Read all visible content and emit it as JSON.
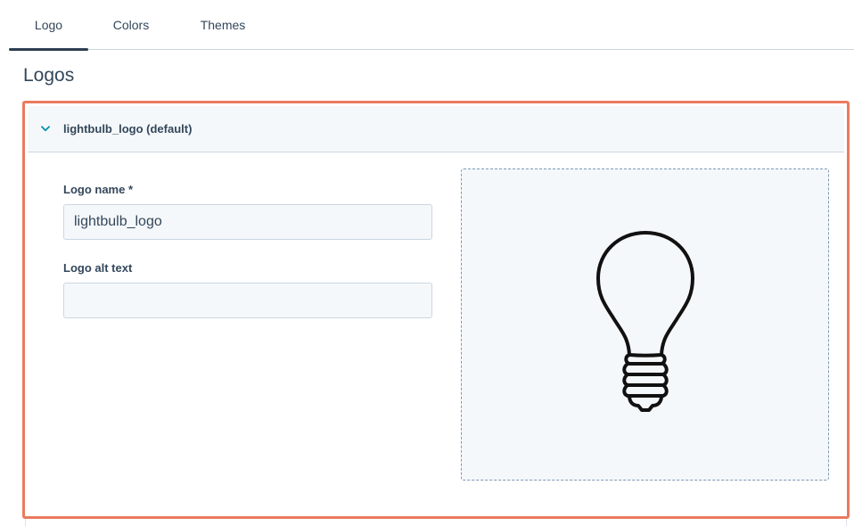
{
  "tabs": [
    {
      "label": "Logo",
      "active": true
    },
    {
      "label": "Colors",
      "active": false
    },
    {
      "label": "Themes",
      "active": false
    }
  ],
  "section": {
    "title": "Logos"
  },
  "logo_card": {
    "title": "lightbulb_logo (default)",
    "expanded_icon": "chevron-down-icon",
    "fields": {
      "name_label": "Logo name *",
      "name_value": "lightbulb_logo",
      "alt_label": "Logo alt text",
      "alt_value": ""
    },
    "preview_icon": "lightbulb-icon"
  },
  "colors": {
    "accent": "#0091ae",
    "text": "#33475b",
    "highlight_border": "#ea7a60",
    "panel_bg": "#f5f8fa"
  }
}
